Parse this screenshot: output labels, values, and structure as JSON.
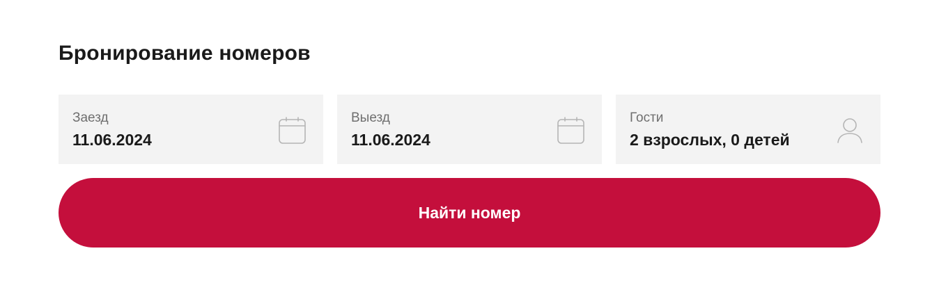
{
  "booking": {
    "title": "Бронирование номеров",
    "checkin": {
      "label": "Заезд",
      "value": "11.06.2024",
      "icon": "calendar-icon"
    },
    "checkout": {
      "label": "Выезд",
      "value": "11.06.2024",
      "icon": "calendar-icon"
    },
    "guests": {
      "label": "Гости",
      "value": "2 взрослых, 0 детей",
      "icon": "user-icon"
    },
    "search_button_label": "Найти номер"
  },
  "colors": {
    "accent": "#c40f3c",
    "field_background": "#f3f3f3",
    "label_text": "#6f6f6f",
    "value_text": "#1a1a1a",
    "icon_stroke": "#b5b5b5"
  }
}
